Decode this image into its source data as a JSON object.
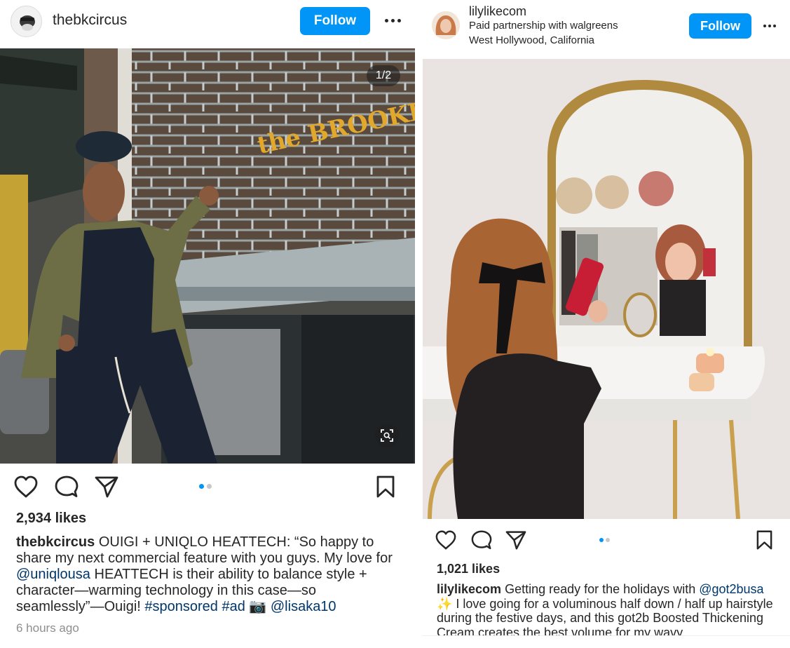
{
  "left_post": {
    "username": "thebkcircus",
    "follow_label": "Follow",
    "image_counter": "1/2",
    "storefront_sign": "the BROOKLYN CIRCUS NY",
    "likes": "2,934 likes",
    "caption": {
      "user": "thebkcircus",
      "text1": " OUIGI + UNIQLO HEATTECH: “So happy to share my next commercial feature with you guys. My love for ",
      "mention1": "@uniqlousa",
      "text2": " HEATTECH is their ability to balance style + character—warming technology in this case—so seamlessly”—Ouigi! ",
      "tag1": "#sponsored",
      "space": " ",
      "tag2": "#ad",
      "emoji": " 📷 ",
      "mention2": "@lisaka10"
    },
    "timestamp": "6 hours ago",
    "carousel_dots": 2,
    "active_dot": 0
  },
  "right_post": {
    "username": "lilylikecom",
    "partnership_prefix": "Paid partnership with ",
    "partner": "walgreens",
    "location": "West Hollywood, California",
    "follow_label": "Follow",
    "likes": "1,021 likes",
    "caption": {
      "user": "lilylikecom",
      "text1": " Getting ready for the holidays with ",
      "mention1": "@got2busa",
      "text2": " ✨ I love going for a voluminous half down / half up hairstyle during the festive days, and this got2b Boosted Thickening Cream creates the best volume for my wavy"
    },
    "carousel_dots": 2,
    "active_dot": 0
  },
  "colors": {
    "follow_blue": "#0095f6",
    "link": "#00376b",
    "text": "#262626",
    "muted": "#8e8e8e"
  }
}
